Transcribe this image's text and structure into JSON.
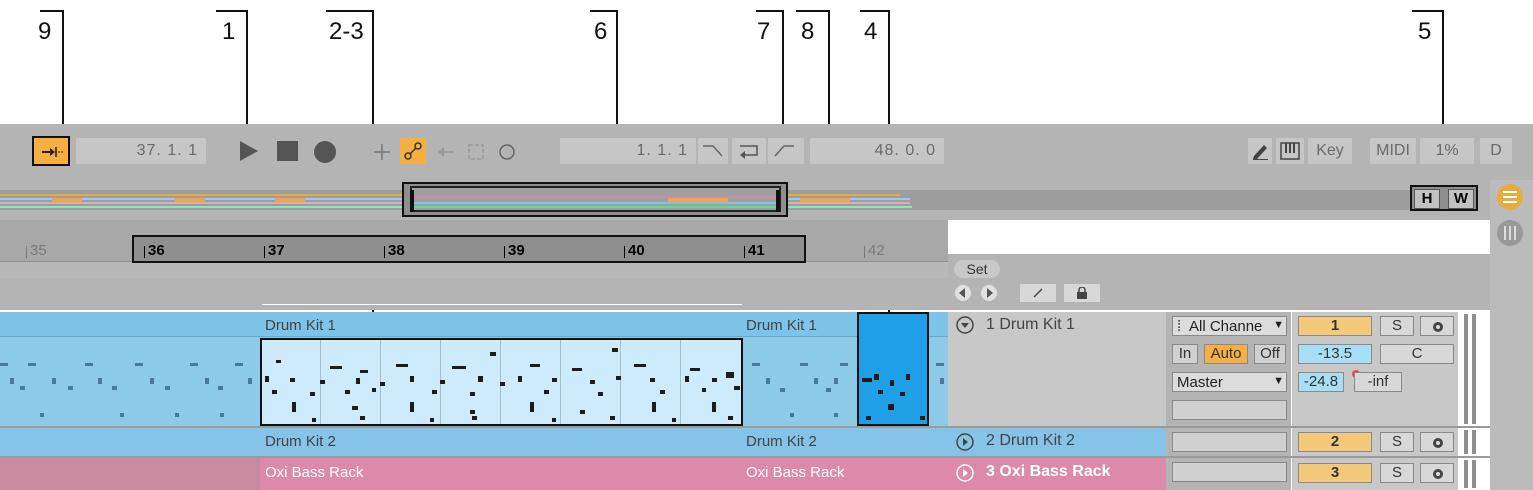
{
  "callouts": [
    "9",
    "1",
    "2-3",
    "6",
    "7",
    "8",
    "4",
    "5"
  ],
  "transport": {
    "position": "37.  1.  1",
    "loop_start": "1.  1.  1",
    "loop_length": "48.  0.  0",
    "key_label": "Key",
    "midi_label": "MIDI",
    "cpu_label": "1%",
    "d_label": "D"
  },
  "overview": {
    "h_label": "H",
    "w_label": "W"
  },
  "ruler": {
    "bars": [
      "35",
      "36",
      "37",
      "38",
      "39",
      "40",
      "41",
      "42"
    ]
  },
  "tracks": [
    {
      "clip_name": "Drum Kit 1",
      "name": "1 Drum Kit 1",
      "input_channel": "All Channe",
      "monitor": [
        "In",
        "Auto",
        "Off"
      ],
      "output": "Master",
      "number": "1",
      "solo": "S",
      "volume": "-13.5",
      "pan": "C",
      "peak": "-24.8",
      "peak2": "-inf"
    },
    {
      "clip_name": "Drum Kit 2",
      "name": "2 Drum Kit 2",
      "number": "2",
      "solo": "S"
    },
    {
      "clip_name": "Oxi Bass Rack",
      "name": "3 Oxi Bass Rack",
      "number": "3",
      "solo": "S"
    }
  ],
  "set_label": "Set",
  "colors": {
    "accent_orange": "#f5b041",
    "clip_blue": "#7ec4e8",
    "selection_light": "#cdebfa",
    "focus_blue": "#1e9fe6",
    "bass_pink": "#dd8aa8",
    "name_blue": "#85c4e6"
  },
  "icons": [
    "follow-icon",
    "play-icon",
    "stop-icon",
    "record-icon",
    "plus-icon",
    "automation-arm-icon",
    "back-arrow-icon",
    "loop-icon",
    "circle-icon",
    "punch-in-icon",
    "loop-switch-icon",
    "punch-out-icon",
    "draw-mode-icon",
    "keyboard-icon",
    "list-icon",
    "grid-icon"
  ]
}
